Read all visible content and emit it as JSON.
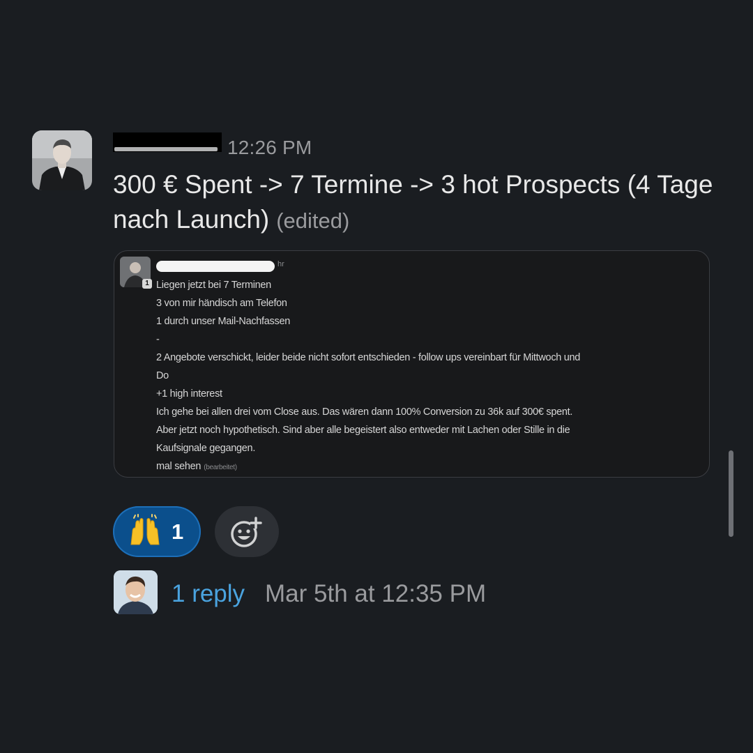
{
  "message": {
    "timestamp": "12:26 PM",
    "text": "300 € Spent -> 7 Termine -> 3 hot Prospects (4 Tage nach Launch)",
    "edited_label": "(edited)"
  },
  "attachment": {
    "header_suffix": "hr",
    "badge": "1",
    "lines": [
      "Liegen jetzt bei 7 Terminen",
      "3 von mir händisch am Telefon",
      "1 durch unser Mail-Nachfassen",
      "-",
      "2 Angebote verschickt, leider beide nicht sofort entschieden - follow ups vereinbart für Mittwoch und",
      "Do",
      "+1 high interest",
      "Ich gehe bei allen drei vom Close aus. Das wären dann 100% Conversion zu 36k auf 300€ spent.",
      "Aber jetzt noch hypothetisch. Sind aber alle begeistert also entweder mit Lachen oder Stille in die",
      "Kaufsignale gegangen.",
      "mal sehen"
    ],
    "last_line_suffix": "(bearbeitet)"
  },
  "reactions": [
    {
      "emoji_name": "raised-hands-icon",
      "count": "1",
      "selected": true
    }
  ],
  "add_reaction_icon": "add-emoji-icon",
  "thread": {
    "reply_label": "1 reply",
    "last_reply_time": "Mar 5th at 12:35 PM"
  },
  "colors": {
    "background": "#1a1d21",
    "link": "#4aa3df",
    "reaction_selected_bg": "#0b4f8c"
  }
}
